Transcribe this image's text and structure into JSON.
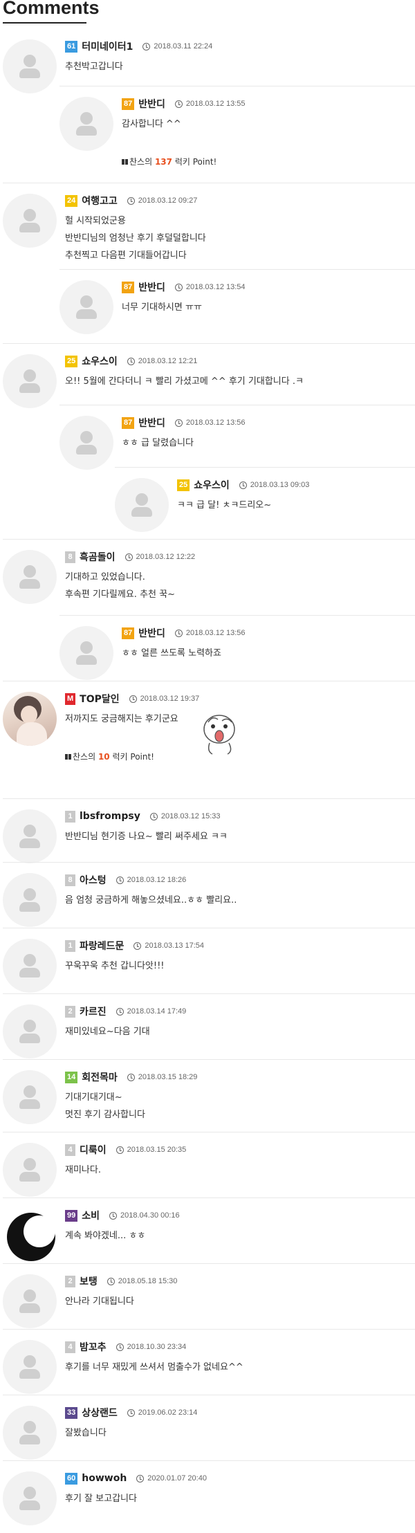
{
  "title": "Comments",
  "comments": [
    {
      "level": "61",
      "color": "#3a9be0",
      "nick": "터미네이터1",
      "date": "2018.03.11 22:24",
      "lines": [
        "추천박고갑니다"
      ]
    },
    {
      "level": "87",
      "color": "#f2a312",
      "nick": "반반디",
      "date": "2018.03.12 13:55",
      "lines": [
        "감사합니다 ^^"
      ],
      "point": {
        "prefix": "찬스의",
        "num": "137",
        "suffix": "럭키 Point!"
      }
    },
    {
      "level": "24",
      "color": "#f3c300",
      "nick": "여행고고",
      "date": "2018.03.12 09:27",
      "lines": [
        "헐 시작되었군용",
        "반반디님의 엄청난 후기 후덜덜합니다",
        "추천찍고 다음편 기대들어갑니다"
      ]
    },
    {
      "level": "87",
      "color": "#f2a312",
      "nick": "반반디",
      "date": "2018.03.12 13:54",
      "lines": [
        "너무 기대하시면 ㅠㅠ"
      ]
    },
    {
      "level": "25",
      "color": "#f3c300",
      "nick": "쇼우스이",
      "date": "2018.03.12 12:21",
      "lines": [
        "오!! 5월에 간다더니 ㅋ 빨리 가셨고메 ^^ 후기 기대합니다 .ㅋ"
      ]
    },
    {
      "level": "87",
      "color": "#f2a312",
      "nick": "반반디",
      "date": "2018.03.12 13:56",
      "lines": [
        "ㅎㅎ 급 달렸습니다"
      ]
    },
    {
      "level": "25",
      "color": "#f3c300",
      "nick": "쇼우스이",
      "date": "2018.03.13 09:03",
      "lines": [
        "ㅋㅋ 급 달! ㅊㅋ드리오~"
      ]
    },
    {
      "level": "8",
      "color": "#c8c8c8",
      "nick": "흑곰돌이",
      "date": "2018.03.12 12:22",
      "lines": [
        "기대하고 있었습니다.",
        "후속편 기다릴께요. 추천 꾹~"
      ]
    },
    {
      "level": "87",
      "color": "#f2a312",
      "nick": "반반디",
      "date": "2018.03.12 13:56",
      "lines": [
        "ㅎㅎ 얼른 쓰도록 노력하죠"
      ]
    },
    {
      "level": "M",
      "color": "#e0282e",
      "nick": "TOP달인",
      "date": "2018.03.12 19:37",
      "lines": [
        "저까지도 궁금해지는 후기군요"
      ],
      "point": {
        "prefix": "찬스의",
        "num": "10",
        "suffix": "럭키 Point!"
      }
    },
    {
      "level": "1",
      "color": "#c8c8c8",
      "nick": "lbsfrompsy",
      "date": "2018.03.12 15:33",
      "lines": [
        "반반디님 현기증 나요~ 빨리 써주세요 ㅋㅋ"
      ]
    },
    {
      "level": "8",
      "color": "#c8c8c8",
      "nick": "아스텅",
      "date": "2018.03.12 18:26",
      "lines": [
        "음 엄청 궁금하게 해놓으셨네요..ㅎㅎ 빨리요.."
      ]
    },
    {
      "level": "1",
      "color": "#c8c8c8",
      "nick": "파랑레드문",
      "date": "2018.03.13 17:54",
      "lines": [
        "꾸욱꾸욱 추천 갑니다앗!!!"
      ]
    },
    {
      "level": "2",
      "color": "#c8c8c8",
      "nick": "카르진",
      "date": "2018.03.14 17:49",
      "lines": [
        "재미있네요~다음 기대"
      ]
    },
    {
      "level": "14",
      "color": "#7cc24a",
      "nick": "회전목마",
      "date": "2018.03.15 18:29",
      "lines": [
        "기대기대기대~",
        "멋진 후기 감사합니다"
      ]
    },
    {
      "level": "4",
      "color": "#c8c8c8",
      "nick": "디룩이",
      "date": "2018.03.15 20:35",
      "lines": [
        "재미나다."
      ]
    },
    {
      "level": "99",
      "color": "#6a3d8a",
      "nick": "소비",
      "date": "2018.04.30 00:16",
      "lines": [
        "계속 봐야겠네... ㅎㅎ"
      ]
    },
    {
      "level": "2",
      "color": "#c8c8c8",
      "nick": "보탱",
      "date": "2018.05.18 15:30",
      "lines": [
        "안나라 기대됩니다"
      ]
    },
    {
      "level": "4",
      "color": "#c8c8c8",
      "nick": "밤꼬추",
      "date": "2018.10.30 23:34",
      "lines": [
        "후기를 너무 재밌게 쓰셔서 멈출수가 없네요^^"
      ]
    },
    {
      "level": "33",
      "color": "#5b4a8e",
      "nick": "상상랜드",
      "date": "2019.06.02 23:14",
      "lines": [
        "잘봤습니다"
      ]
    },
    {
      "level": "60",
      "color": "#3a9be0",
      "nick": "howwoh",
      "date": "2020.01.07 20:40",
      "lines": [
        "후기 잘 보고갑니다"
      ]
    }
  ]
}
